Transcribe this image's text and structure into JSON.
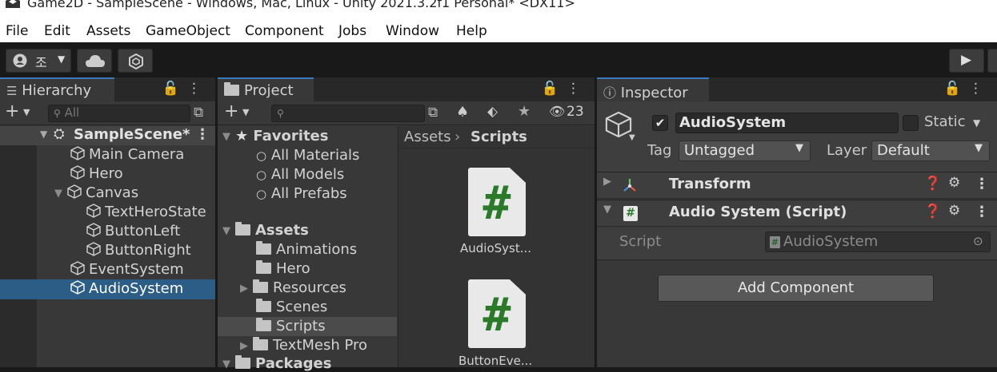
{
  "window": {
    "title": "Game2D - SampleScene - Windows, Mac, Linux - Unity 2021.3.2f1 Personal* <DX11>"
  },
  "menu": [
    "File",
    "Edit",
    "Assets",
    "GameObject",
    "Component",
    "Jobs",
    "Window",
    "Help"
  ],
  "toolbar": {
    "account_label": "조"
  },
  "hierarchy": {
    "tab": "Hierarchy",
    "search_placeholder": "All",
    "scene": "SampleScene*",
    "items": [
      "Main Camera",
      "Hero",
      "Canvas",
      "TextHeroState",
      "ButtonLeft",
      "ButtonRight",
      "EventSystem",
      "AudioSystem"
    ],
    "selected": "AudioSystem"
  },
  "project": {
    "tab": "Project",
    "hidden_count": "23",
    "favorites": {
      "label": "Favorites",
      "items": [
        "All Materials",
        "All Models",
        "All Prefabs"
      ]
    },
    "assets": {
      "label": "Assets",
      "items": [
        "Animations",
        "Hero",
        "Resources",
        "Scenes",
        "Scripts",
        "TextMesh Pro"
      ]
    },
    "packages": "Packages",
    "breadcrumb": [
      "Assets",
      "Scripts"
    ],
    "files": [
      "AudioSyst...",
      "ButtonEve..."
    ]
  },
  "inspector": {
    "tab": "Inspector",
    "object_name": "AudioSystem",
    "static_label": "Static",
    "tag_label": "Tag",
    "tag_value": "Untagged",
    "layer_label": "Layer",
    "layer_value": "Default",
    "components": [
      "Transform",
      "Audio System (Script)"
    ],
    "script_label": "Script",
    "script_value": "AudioSystem",
    "add_component": "Add Component"
  },
  "colors": {
    "selection": "#2c5d87",
    "accent": "#3a79bb",
    "script_green": "#2a7a2a"
  }
}
